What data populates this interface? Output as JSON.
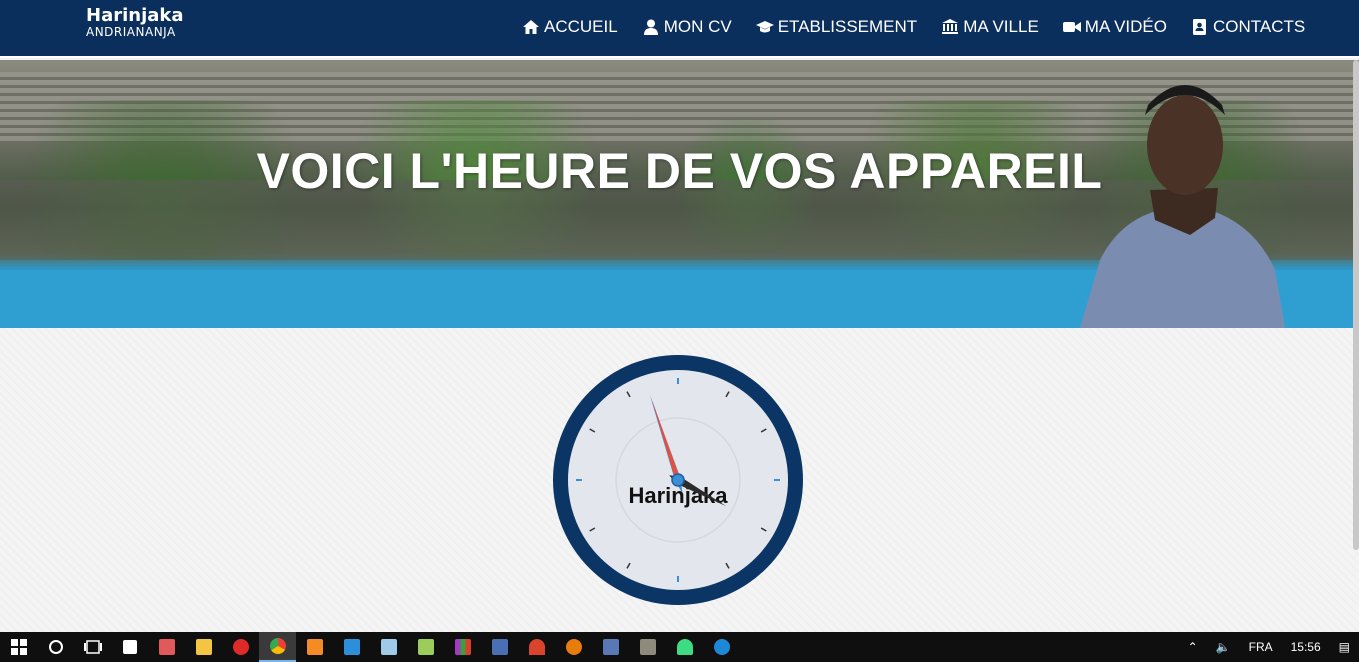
{
  "brand": {
    "first": "Harinjaka",
    "last": "ANDRIANANJA"
  },
  "nav": [
    {
      "label": "ACCUEIL",
      "icon": "home-icon"
    },
    {
      "label": "MON CV",
      "icon": "user-icon"
    },
    {
      "label": "ETABLISSEMENT",
      "icon": "graduation-cap-icon"
    },
    {
      "label": "MA VILLE",
      "icon": "institution-icon"
    },
    {
      "label": "MA VIDÉO",
      "icon": "video-camera-icon"
    },
    {
      "label": "CONTACTS",
      "icon": "address-book-icon"
    }
  ],
  "hero": {
    "title": "VOICI L'HEURE DE VOS APPAREIL"
  },
  "clock": {
    "label": "Harinjaka",
    "hour": 15,
    "minute": 56,
    "second": 57
  },
  "taskbar": {
    "apps": [
      "windows-start-icon",
      "cortana-icon",
      "task-view-icon",
      "store-icon",
      "paint-icon",
      "file-explorer-icon",
      "opera-icon",
      "chrome-icon",
      "sublime-icon",
      "vscode-icon",
      "notepad-icon",
      "notepad-plus-icon",
      "winrar-icon",
      "cpu-z-icon",
      "app-icon",
      "blender-icon",
      "git-icon",
      "gimp-icon",
      "android-studio-icon",
      "edge-icon"
    ],
    "lang": "FRA",
    "time": "15:56"
  },
  "colors": {
    "navbar": "#0b2f5c",
    "clock_ring": "#0b3565",
    "second_hand": "#e94e3c",
    "minute_hand": "#3a8fd6"
  }
}
